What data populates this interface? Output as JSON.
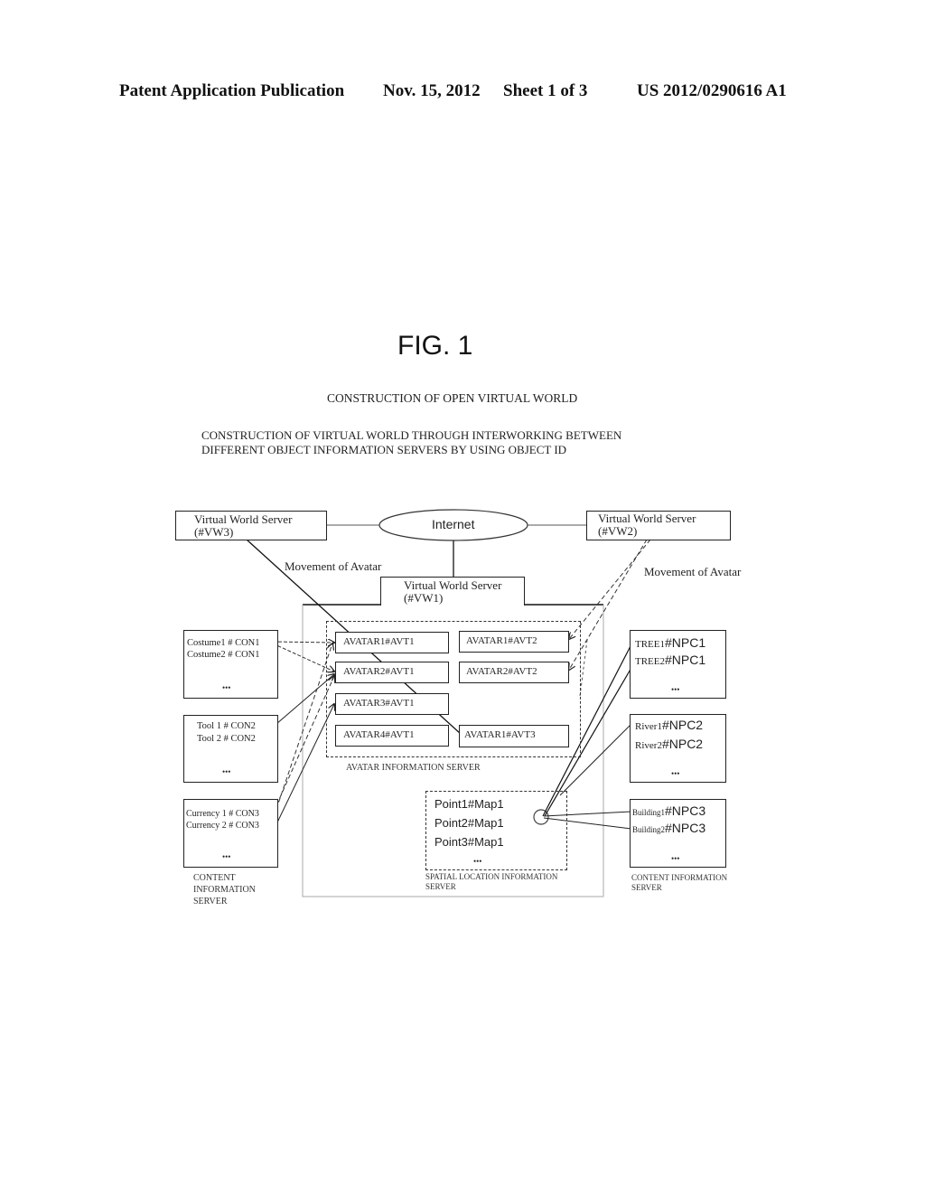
{
  "header": {
    "publication_type": "Patent Application Publication",
    "date": "Nov. 15, 2012",
    "sheet": "Sheet 1 of 3",
    "patent_number": "US 2012/0290616 A1"
  },
  "figure": {
    "label": "FIG. 1",
    "title": "CONSTRUCTION OF OPEN VIRTUAL WORLD",
    "subtitle_line1": "CONSTRUCTION OF VIRTUAL WORLD THROUGH INTERWORKING BETWEEN",
    "subtitle_line2": "DIFFERENT OBJECT INFORMATION SERVERS BY USING OBJECT ID"
  },
  "diagram": {
    "internet": "Internet",
    "vw3": {
      "line1": "Virtual World Server",
      "line2": "(#VW3)"
    },
    "vw2": {
      "line1": "Virtual World Server",
      "line2": "(#VW2)"
    },
    "vw1": {
      "line1": "Virtual World Server",
      "line2": "(#VW1)"
    },
    "movement_left": "Movement of Avatar",
    "movement_right": "Movement of Avatar",
    "avatars": [
      "AVATAR1#AVT1",
      "AVATAR2#AVT1",
      "AVATAR3#AVT1",
      "AVATAR4#AVT1",
      "AVATAR1#AVT2",
      "AVATAR2#AVT2",
      "AVATAR1#AVT3"
    ],
    "avatar_server_label": "AVATAR INFORMATION SERVER",
    "content_left": [
      {
        "line1": "Costume1 # CON1",
        "line2": "Costume2 # CON1",
        "more": "•••"
      },
      {
        "line1": "Tool 1 # CON2",
        "line2": "Tool 2 # CON2",
        "more": "•••"
      },
      {
        "line1": "Currency 1 # CON3",
        "line2": "Currency 2 # CON3",
        "more": "•••"
      }
    ],
    "content_left_label": [
      "CONTENT",
      "INFORMATION",
      "SERVER"
    ],
    "spatial": {
      "line1": "Point1#Map1",
      "line2": "Point2#Map1",
      "line3": "Point3#Map1",
      "more": "•••"
    },
    "spatial_label": [
      "SPATIAL LOCATION INFORMATION",
      "SERVER"
    ],
    "content_right": [
      {
        "p1": "TREE1",
        "s1": "#NPC1",
        "p2": "TREE2",
        "s2": "#NPC1",
        "more": "•••"
      },
      {
        "p1": "River1",
        "s1": "#NPC2",
        "p2": "River2",
        "s2": "#NPC2",
        "more": "•••"
      },
      {
        "p1": "Building1",
        "s1": "#NPC3",
        "p2": "Building2",
        "s2": "#NPC3",
        "more": "•••"
      }
    ],
    "content_right_label": [
      "CONTENT INFORMATION",
      "SERVER"
    ]
  }
}
